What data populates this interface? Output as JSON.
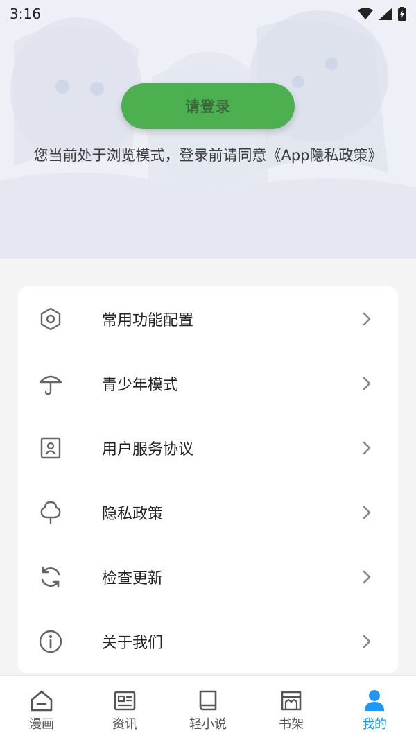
{
  "status_bar": {
    "time": "3:16"
  },
  "header": {
    "login_label": "请登录",
    "notice": "您当前处于浏览模式，登录前请同意《App隐私政策》"
  },
  "menu": {
    "items": [
      {
        "label": "常用功能配置",
        "icon": "hexagon-settings-icon"
      },
      {
        "label": "青少年模式",
        "icon": "umbrella-icon"
      },
      {
        "label": "用户服务协议",
        "icon": "contact-card-icon"
      },
      {
        "label": "隐私政策",
        "icon": "tree-icon"
      },
      {
        "label": "检查更新",
        "icon": "refresh-icon"
      },
      {
        "label": "关于我们",
        "icon": "info-icon"
      }
    ]
  },
  "bottom_nav": {
    "items": [
      {
        "label": "漫画",
        "icon": "home-icon",
        "active": false
      },
      {
        "label": "资讯",
        "icon": "news-icon",
        "active": false
      },
      {
        "label": "轻小说",
        "icon": "book-icon",
        "active": false
      },
      {
        "label": "书架",
        "icon": "bookshelf-icon",
        "active": false
      },
      {
        "label": "我的",
        "icon": "person-icon",
        "active": true
      }
    ]
  },
  "colors": {
    "accent_green": "#4caf50",
    "active_blue": "#2196f3",
    "icon_gray": "#666666"
  }
}
